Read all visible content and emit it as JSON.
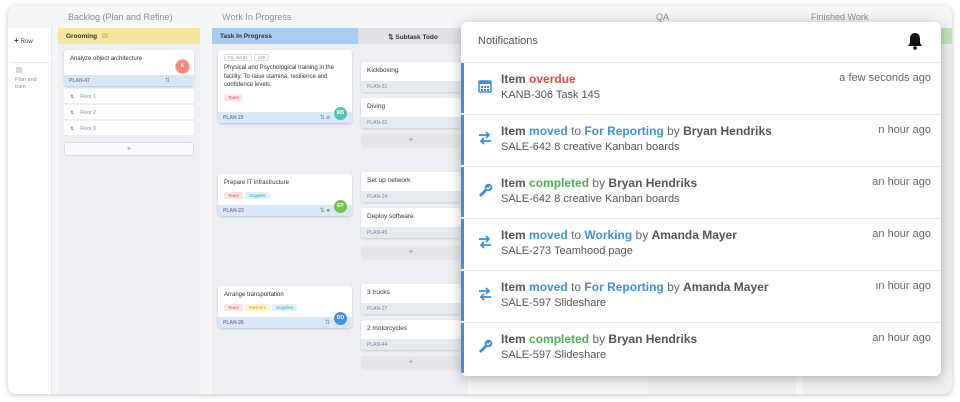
{
  "columns": {
    "backlog": "Backlog (Plan and Refine)",
    "wip": "Work In Progress",
    "qa": "QA",
    "finished": "Finished Work"
  },
  "left": {
    "add_row": "Row",
    "row_label_1": "Plan and",
    "row_label_2": "train"
  },
  "lanes": {
    "grooming": "Grooming",
    "task_in_progress": "Task In Progress",
    "subtask_todo": "Subtask Todo"
  },
  "grooming": {
    "card1": {
      "title": "Analyze object architecture",
      "id": "PLAN-47"
    },
    "subtasks": [
      "Floor 1",
      "Floor 2",
      "Floor 3"
    ],
    "add": "+"
  },
  "progress": {
    "card1": {
      "chip1": "Fri, Jul 31",
      "chip2": "12h",
      "title": "Physical and Psychological training in the facility. To raise stamina, resilience and confidence levels.",
      "tag": "Team",
      "id": "PLAN 29",
      "avatar": "MS"
    },
    "card2": {
      "title": "Prepare IT infrastructure",
      "tag1": "Team",
      "tag2": "Supplies",
      "id": "PLAN-23",
      "avatar": "EP"
    },
    "card3": {
      "title": "Arrange transportation",
      "tag1": "Team",
      "tag2": "Partners",
      "tag3": "Supplies",
      "id": "PLAN-26",
      "avatar": "DD"
    }
  },
  "subtask_col": {
    "t1": {
      "title": "Kickboxing",
      "id": "PLAN-31"
    },
    "t2": {
      "title": "Diving",
      "id": "PLAN-32"
    },
    "t3": {
      "title": "Set up network",
      "id": "PLAN-24"
    },
    "t4": {
      "title": "Deploy software",
      "id": "PLAN-45"
    },
    "t5": {
      "title": "3 trucks",
      "id": "PLAN-27"
    },
    "t6": {
      "title": "2 motorcycles",
      "id": "PLAN-44"
    },
    "add": "+"
  },
  "notifications": {
    "title": "Notifications",
    "items": [
      {
        "icon": "calendar-icon",
        "lead": "Item",
        "kw": "overdue",
        "kw_color": "red",
        "mid": "",
        "target": "",
        "by": "",
        "person": "",
        "sub": "KANB-306 Task 145",
        "time": "a few seconds ago"
      },
      {
        "icon": "arrows-icon",
        "lead": "Item",
        "kw": "moved",
        "kw_color": "blue",
        "mid": "to",
        "target": "For Reporting",
        "by": "by",
        "person": "Bryan Hendriks",
        "sub": "SALE-642 8 creative Kanban boards",
        "time": "n hour ago"
      },
      {
        "icon": "check-icon",
        "lead": "Item",
        "kw": "completed",
        "kw_color": "green",
        "mid": "",
        "target": "",
        "by": "by",
        "person": "Bryan Hendriks",
        "sub": "SALE-642 8 creative Kanban boards",
        "time": "an hour ago"
      },
      {
        "icon": "arrows-icon",
        "lead": "Item",
        "kw": "moved",
        "kw_color": "blue",
        "mid": "to",
        "target": "Working",
        "by": "by",
        "person": "Amanda Mayer",
        "sub": "SALE-273 Teamhood page",
        "time": "an hour ago"
      },
      {
        "icon": "arrows-icon",
        "lead": "Item",
        "kw": "moved",
        "kw_color": "blue",
        "mid": "to",
        "target": "For Reporting",
        "by": "by",
        "person": "Amanda Mayer",
        "sub": "SALE-597 Slideshare",
        "time": "ın hour ago"
      },
      {
        "icon": "check-icon",
        "lead": "Item",
        "kw": "completed",
        "kw_color": "green",
        "mid": "",
        "target": "",
        "by": "by",
        "person": "Bryan Hendriks",
        "sub": "SALE-597 Slideshare",
        "time": "an hour ago"
      }
    ]
  },
  "colors": {
    "accent": "#3d8fd8",
    "grooming": "#f3e6a0",
    "in_progress": "#a9cdee",
    "red": "#e24a3b",
    "green": "#4caf50"
  }
}
